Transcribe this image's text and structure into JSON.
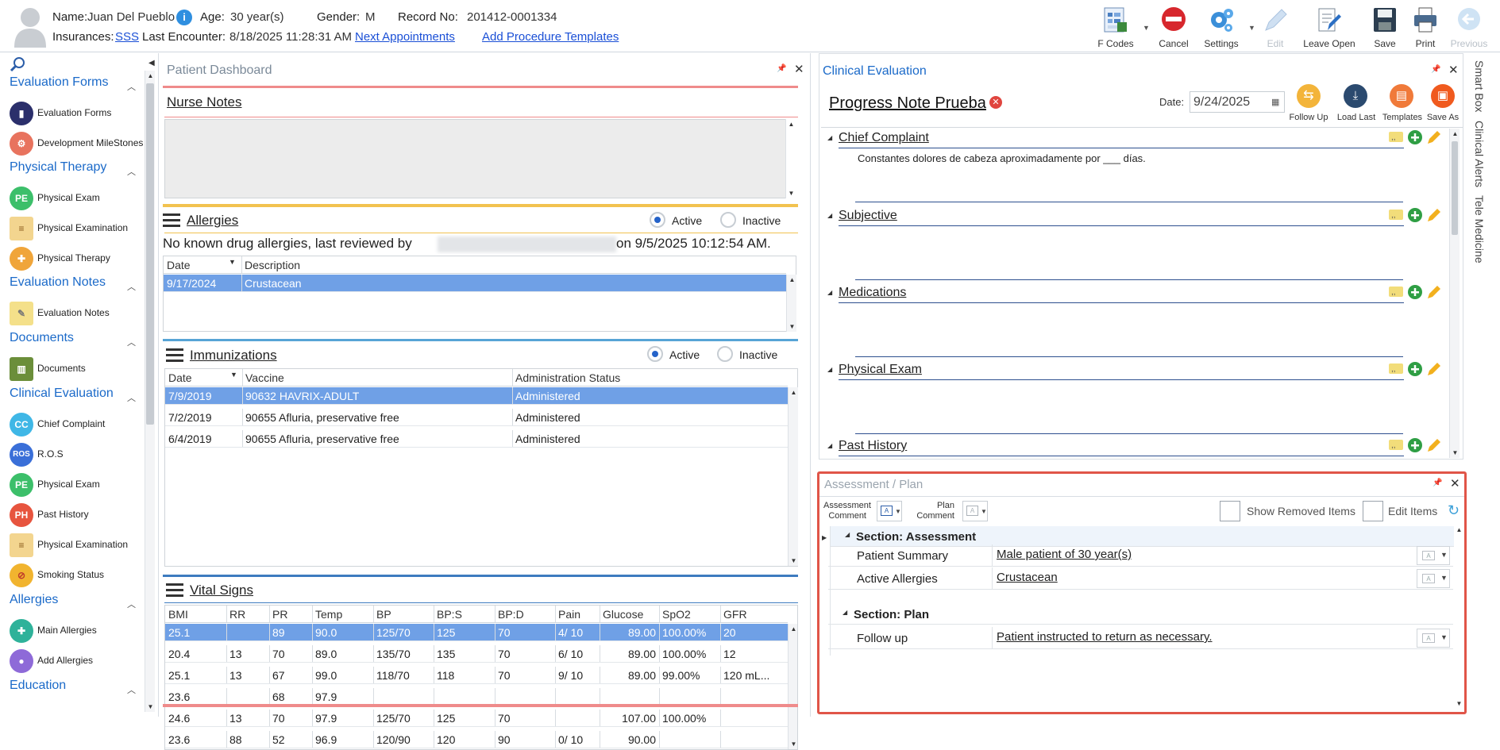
{
  "header": {
    "name_label": "Name:",
    "name_value": "Juan Del Pueblo",
    "age_label": "Age:",
    "age_value": "30 year(s)",
    "gender_label": "Gender:",
    "gender_value": "M",
    "record_label": "Record No:",
    "record_value": "201412-0001334",
    "insurances_label": "Insurances:",
    "insurances_value": "SSS",
    "last_encounter_label": "Last Encounter:",
    "last_encounter_value": "8/18/2025 11:28:31 AM",
    "next_appointments": "Next Appointments",
    "add_procedure_templates": "Add Procedure Templates"
  },
  "toolbar": {
    "fcodes": "F Codes",
    "cancel": "Cancel",
    "settings": "Settings",
    "edit": "Edit",
    "leave_open": "Leave Open",
    "save": "Save",
    "print": "Print",
    "previous": "Previous"
  },
  "sidebar": {
    "groups": [
      {
        "title": "Evaluation Forms",
        "items": [
          "Evaluation Forms",
          "Development MileStones"
        ]
      },
      {
        "title": "Physical Therapy",
        "items": [
          "Physical Exam",
          "Physical Examination",
          "Physical Therapy"
        ]
      },
      {
        "title": "Evaluation Notes",
        "items": [
          "Evaluation Notes"
        ]
      },
      {
        "title": "Documents",
        "items": [
          "Documents"
        ]
      },
      {
        "title": "Clinical Evaluation",
        "items": [
          "Chief Complaint",
          "R.O.S",
          "Physical Exam",
          "Past History",
          "Physical Examination",
          "Smoking Status"
        ]
      },
      {
        "title": "Allergies",
        "items": [
          "Main Allergies",
          "Add Allergies"
        ]
      },
      {
        "title": "Education",
        "items": []
      }
    ],
    "icon_text": {
      "pe": "PE",
      "cc": "CC",
      "ros": "ROS",
      "ph": "PH"
    }
  },
  "dashboard": {
    "title": "Patient Dashboard",
    "nurse_notes": "Nurse Notes",
    "allergies": {
      "title": "Allergies",
      "active": "Active",
      "inactive": "Inactive",
      "note_prefix": "No known drug allergies, last reviewed by",
      "note_suffix": "on 9/5/2025 10:12:54 AM.",
      "columns": [
        "Date",
        "Description"
      ],
      "rows": [
        [
          "9/17/2024",
          "Crustacean"
        ]
      ]
    },
    "immunizations": {
      "title": "Immunizations",
      "active": "Active",
      "inactive": "Inactive",
      "columns": [
        "Date",
        "Vaccine",
        "Administration Status"
      ],
      "rows": [
        [
          "7/9/2019",
          "90632 HAVRIX-ADULT",
          "Administered"
        ],
        [
          "7/2/2019",
          "90655 Afluria, preservative free",
          "Administered"
        ],
        [
          "6/4/2019",
          "90655 Afluria, preservative free",
          "Administered"
        ]
      ]
    },
    "vitals": {
      "title": "Vital Signs",
      "columns": [
        "BMI",
        "RR",
        "PR",
        "Temp",
        "BP",
        "BP:S",
        "BP:D",
        "Pain",
        "Glucose",
        "SpO2",
        "GFR"
      ],
      "rows": [
        [
          "25.1",
          "",
          "89",
          "90.0",
          "125/70",
          "125",
          "70",
          "4/ 10",
          "89.00",
          "100.00%",
          "20"
        ],
        [
          "20.4",
          "13",
          "70",
          "89.0",
          "135/70",
          "135",
          "70",
          "6/ 10",
          "89.00",
          "100.00%",
          "12"
        ],
        [
          "25.1",
          "13",
          "67",
          "99.0",
          "118/70",
          "118",
          "70",
          "9/ 10",
          "89.00",
          "99.00%",
          "120 mL..."
        ],
        [
          "23.6",
          "",
          "68",
          "97.9",
          "",
          "",
          "",
          "",
          "",
          "",
          ""
        ],
        [
          "24.6",
          "13",
          "70",
          "97.9",
          "125/70",
          "125",
          "70",
          "",
          "107.00",
          "100.00%",
          ""
        ],
        [
          "23.6",
          "88",
          "52",
          "96.9",
          "120/90",
          "120",
          "90",
          "0/ 10",
          "90.00",
          "",
          ""
        ]
      ]
    }
  },
  "clinical_eval": {
    "title": "Clinical Evaluation",
    "note_title": "Progress Note Prueba",
    "date_label": "Date:",
    "date_value": "9/24/2025",
    "buttons": [
      "Follow Up",
      "Load Last",
      "Templates",
      "Save As"
    ],
    "sections": [
      {
        "name": "Chief Complaint",
        "text": "Constantes dolores de cabeza aproximadamente por ___ días."
      },
      {
        "name": "Subjective",
        "text": ""
      },
      {
        "name": "Medications",
        "text": ""
      },
      {
        "name": "Physical Exam",
        "text": ""
      },
      {
        "name": "Past History",
        "text": ""
      }
    ]
  },
  "assessment_plan": {
    "title": "Assessment / Plan",
    "assessment_comment": "Assessment Comment",
    "assessment_comment_l1": "Assessment",
    "assessment_comment_l2": "Comment",
    "plan_comment_l1": "Plan",
    "plan_comment_l2": "Comment",
    "show_removed": "Show Removed Items",
    "edit_items": "Edit Items",
    "section_assessment": "Section: Assessment",
    "section_plan": "Section: Plan",
    "rows": [
      {
        "key": "Patient Summary",
        "value": "Male patient of 30 year(s)"
      },
      {
        "key": "Active Allergies",
        "value": "Crustacean"
      },
      {
        "key": "Follow up",
        "value": "Patient instructed to return as necessary."
      }
    ]
  },
  "right_tabs": [
    "Smart Box",
    "Clinical Alerts",
    "Tele Medicine"
  ],
  "colors": {
    "accent": "#1b6ac9",
    "selected_row": "#6fa0e6",
    "highlight_border": "#e05548"
  }
}
